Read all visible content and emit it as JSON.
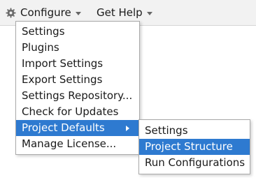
{
  "menubar": {
    "configure_label": "Configure",
    "get_help_label": "Get Help",
    "configure_icon": "gear-icon",
    "dropdown_icon": "chevron-down-icon"
  },
  "configure_menu": {
    "items": [
      {
        "label": "Settings"
      },
      {
        "label": "Plugins"
      },
      {
        "label": "Import Settings"
      },
      {
        "label": "Export Settings"
      },
      {
        "label": "Settings Repository..."
      },
      {
        "label": "Check for Updates"
      },
      {
        "label": "Project Defaults",
        "selected": true,
        "has_submenu": true
      },
      {
        "label": "Manage License..."
      }
    ]
  },
  "project_defaults_submenu": {
    "items": [
      {
        "label": "Settings"
      },
      {
        "label": "Project Structure",
        "selected": true
      },
      {
        "label": "Run Configurations"
      }
    ]
  },
  "colors": {
    "selection": "#2e7ad0",
    "menubar_bg": "#f2f2f2"
  }
}
